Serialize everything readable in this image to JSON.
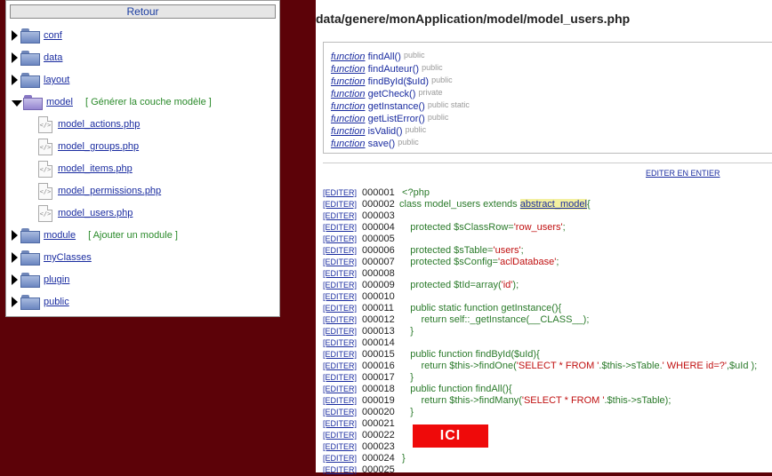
{
  "left_panel": {
    "retour": "Retour",
    "tree": [
      {
        "label": "conf",
        "type": "folder",
        "state": "closed"
      },
      {
        "label": "data",
        "type": "folder",
        "state": "closed"
      },
      {
        "label": "layout",
        "type": "folder",
        "state": "closed"
      },
      {
        "label": "model",
        "type": "folder",
        "state": "open",
        "action": "[ Générer la couche modèle ]"
      },
      {
        "label": "model_actions.php",
        "type": "file"
      },
      {
        "label": "model_groups.php",
        "type": "file"
      },
      {
        "label": "model_items.php",
        "type": "file"
      },
      {
        "label": "model_permissions.php",
        "type": "file"
      },
      {
        "label": "model_users.php",
        "type": "file"
      },
      {
        "label": "module",
        "type": "folder",
        "state": "closed",
        "action": "[ Ajouter un module ]"
      },
      {
        "label": "myClasses",
        "type": "folder",
        "state": "closed"
      },
      {
        "label": "plugin",
        "type": "folder",
        "state": "closed"
      },
      {
        "label": "public",
        "type": "folder",
        "state": "closed"
      }
    ]
  },
  "right_panel": {
    "file_path": "data/genere/monApplication/model/model_users.php",
    "methods": [
      {
        "keyword": "function",
        "name": "findAll()",
        "visibility": "public"
      },
      {
        "keyword": "function",
        "name": "findAuteur()",
        "visibility": "public"
      },
      {
        "keyword": "function",
        "name": "findById($uId)",
        "visibility": "public"
      },
      {
        "keyword": "function",
        "name": "getCheck()",
        "visibility": "private"
      },
      {
        "keyword": "function",
        "name": "getInstance()",
        "visibility": "public static"
      },
      {
        "keyword": "function",
        "name": "getListError()",
        "visibility": "public"
      },
      {
        "keyword": "function",
        "name": "isValid()",
        "visibility": "public"
      },
      {
        "keyword": "function",
        "name": "save()",
        "visibility": "public"
      }
    ],
    "edit_all": "EDITER EN ENTIER",
    "edit_label": "[EDITER]",
    "code_lines": [
      {
        "no": "000001",
        "code": " <?php"
      },
      {
        "no": "000002",
        "code": "class model_users extends ",
        "hl": "abstract_model",
        "after": "{"
      },
      {
        "no": "000003",
        "code": ""
      },
      {
        "no": "000004",
        "code": "    protected $sClassRow=",
        "str": "'row_users'",
        "tail": ";"
      },
      {
        "no": "000005",
        "code": ""
      },
      {
        "no": "000006",
        "code": "    protected $sTable=",
        "str": "'users'",
        "tail": ";"
      },
      {
        "no": "000007",
        "code": "    protected $sConfig=",
        "str": "'aclDatabase'",
        "tail": ";"
      },
      {
        "no": "000008",
        "code": ""
      },
      {
        "no": "000009",
        "code": "    protected $tId=array(",
        "str": "'id'",
        "tail": ");"
      },
      {
        "no": "000010",
        "code": ""
      },
      {
        "no": "000011",
        "code": "    public static function getInstance(){"
      },
      {
        "no": "000012",
        "code": "        return self::_getInstance(__CLASS__);"
      },
      {
        "no": "000013",
        "code": "    }"
      },
      {
        "no": "000014",
        "code": ""
      },
      {
        "no": "000015",
        "code": "    public function findById($uId){"
      },
      {
        "no": "000016",
        "code": "        return $this->findOne(",
        "str": "'SELECT * FROM '",
        "tail": ".$this->sTable.",
        "str2": "' WHERE id=?'",
        "tail2": ",$uId );"
      },
      {
        "no": "000017",
        "code": "    }"
      },
      {
        "no": "000018",
        "code": "    public function findAll(){"
      },
      {
        "no": "000019",
        "code": "        return $this->findMany(",
        "str": "'SELECT * FROM '",
        "tail": ".$this->sTable);"
      },
      {
        "no": "000020",
        "code": "    }"
      },
      {
        "no": "000021",
        "code": ""
      },
      {
        "no": "000022",
        "code": ""
      },
      {
        "no": "000023",
        "code": ""
      },
      {
        "no": "000024",
        "code": " }"
      },
      {
        "no": "000025",
        "code": ""
      }
    ],
    "ici_label": "ICI"
  }
}
